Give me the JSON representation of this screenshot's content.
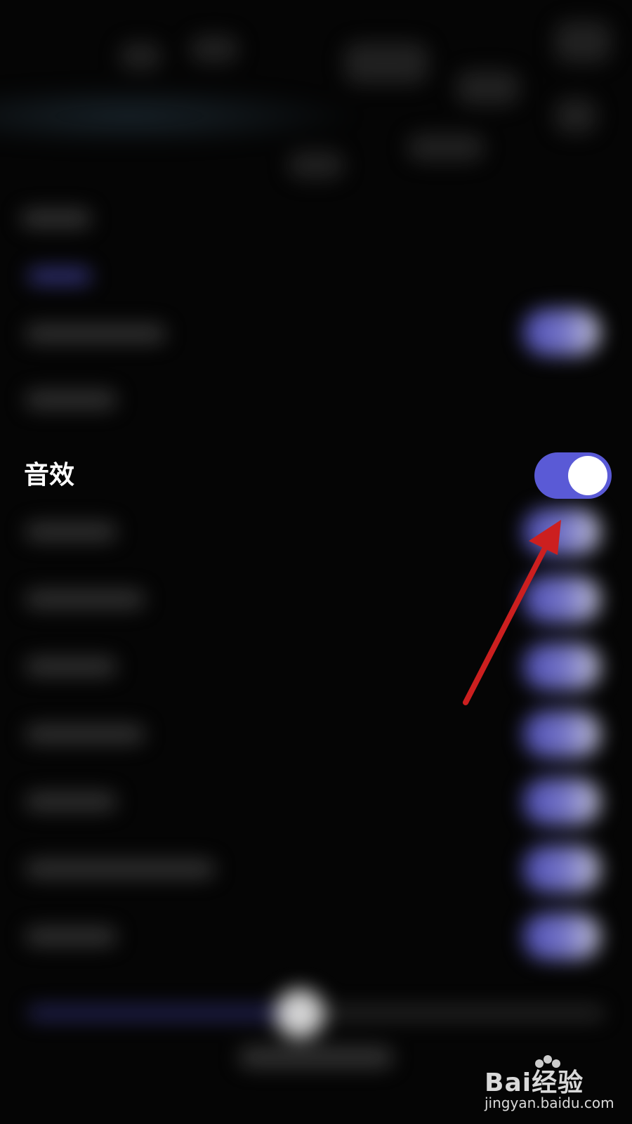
{
  "setting_row": {
    "label": "音效",
    "toggle_state": "on"
  },
  "colors": {
    "background": "#050505",
    "toggle_on": "#5a5ad6",
    "annotation_arrow": "#cc1f1f",
    "text": "#ffffff"
  },
  "watermark": {
    "brand": "Bai经验",
    "url": "jingyan.baidu.com"
  },
  "icons": {
    "annotation": "red-arrow-icon",
    "watermark_logo": "baidu-paw-icon"
  }
}
